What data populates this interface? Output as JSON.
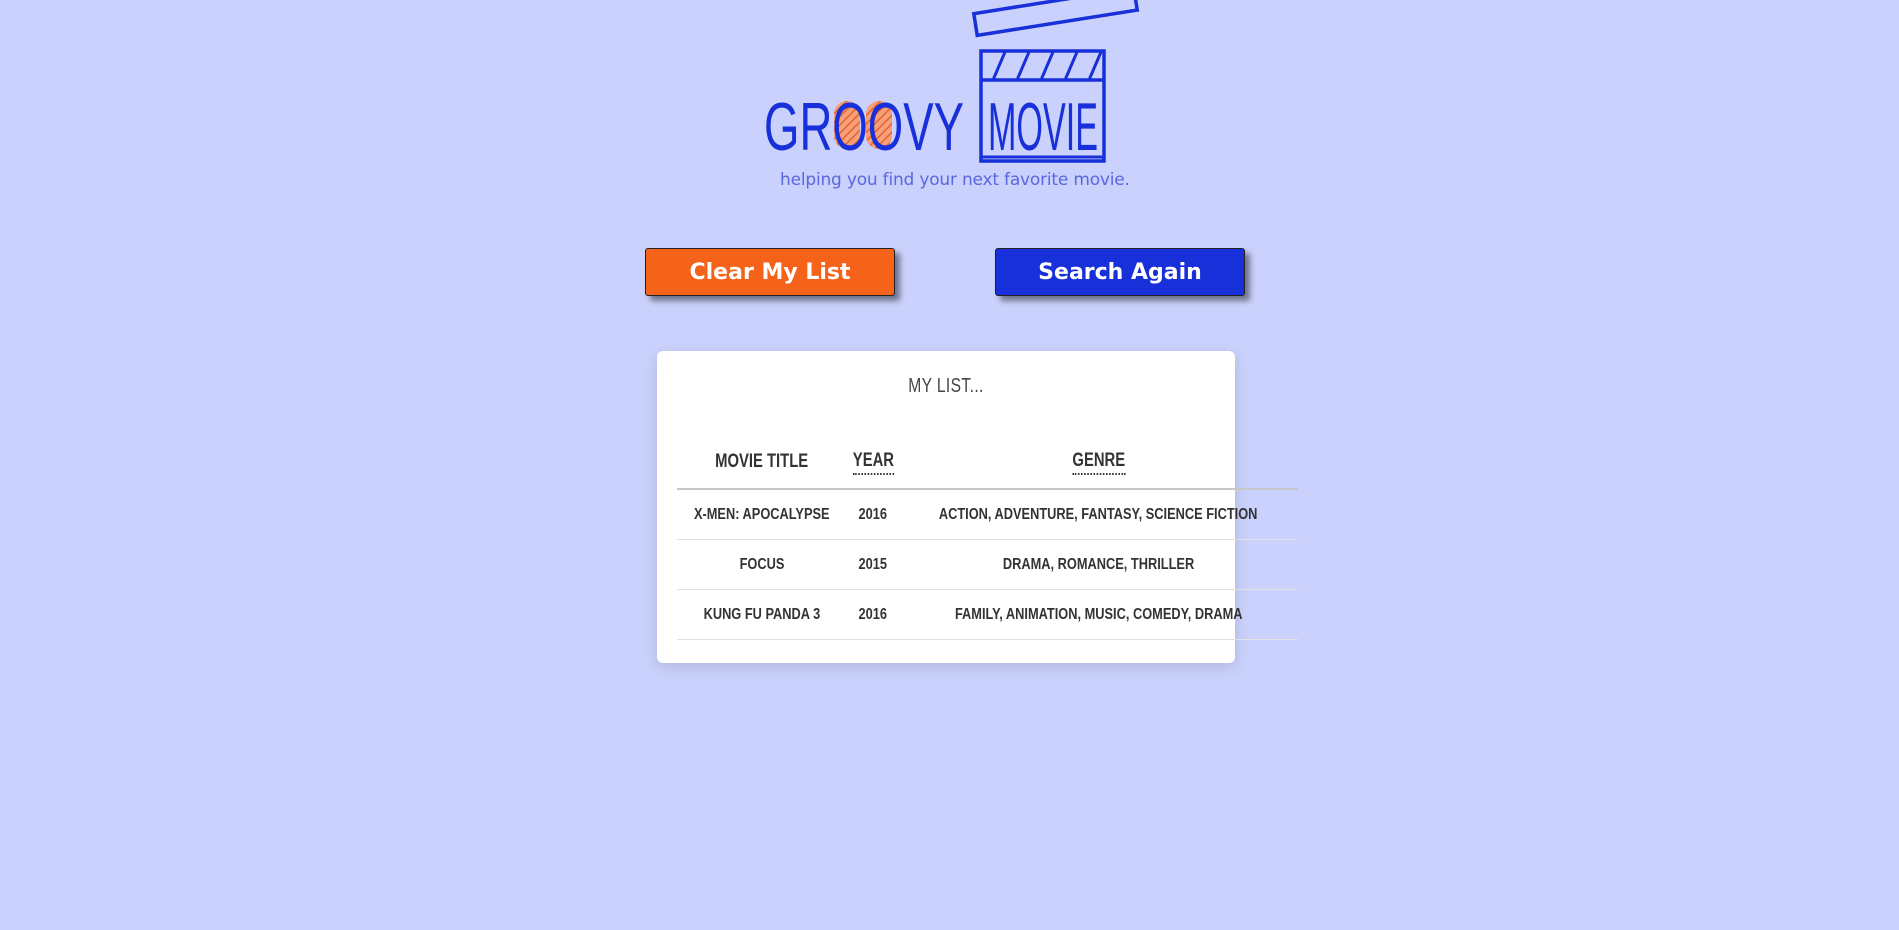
{
  "brand": {
    "word1": "GROOVY",
    "word2": "MOVIE",
    "tagline": "helping you find your next favorite movie.",
    "primary_color": "#1830d9",
    "accent_color": "#f5621a",
    "logo_icon": "clapperboard-icon"
  },
  "actions": {
    "clear_label": "Clear My List",
    "search_label": "Search Again"
  },
  "list": {
    "title": "MY LIST...",
    "columns": [
      "MOVIE TITLE",
      "YEAR",
      "GENRE"
    ],
    "rows": [
      {
        "title": "X-MEN: APOCALYPSE",
        "year": "2016",
        "genre": "ACTION, ADVENTURE, FANTASY, SCIENCE FICTION"
      },
      {
        "title": "FOCUS",
        "year": "2015",
        "genre": "DRAMA, ROMANCE, THRILLER"
      },
      {
        "title": "KUNG FU PANDA 3",
        "year": "2016",
        "genre": "FAMILY, ANIMATION, MUSIC, COMEDY, DRAMA"
      }
    ]
  }
}
